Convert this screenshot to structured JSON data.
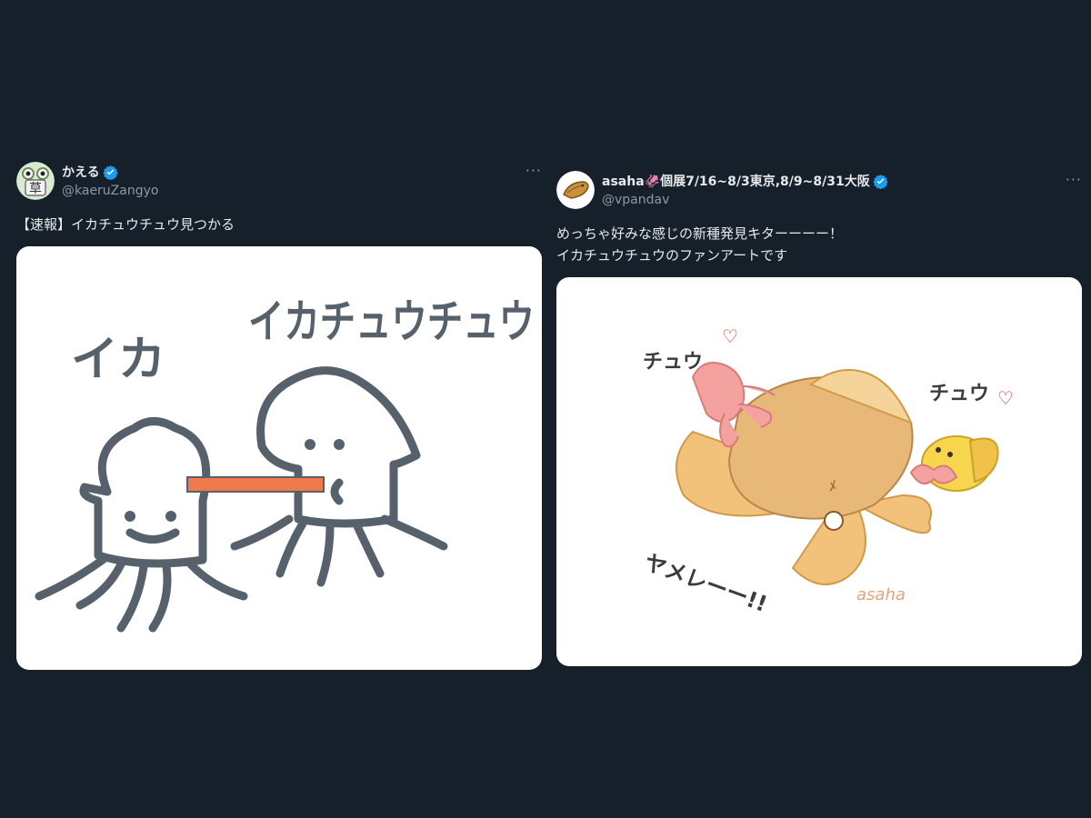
{
  "tweets": [
    {
      "display_name": "かえる",
      "handle": "@kaeruZangyo",
      "verified": true,
      "avatar_icon": "frog-avatar-icon",
      "text": "【速報】イカチュウチュウ見つかる",
      "more_label": "···",
      "media": {
        "description_icon": "squid-drawing-icon",
        "labels": [
          "イカ",
          "イカチュウチュウ"
        ]
      }
    },
    {
      "display_name": "asaha🦑個展7/16~8/3東京,8/9~8/31大阪",
      "handle": "@vpandav",
      "verified": true,
      "avatar_icon": "taiyaki-avatar-icon",
      "text": "めっちゃ好みな感じの新種発見キターーーー！\nイカチュウチュウのファンアートです",
      "more_label": "···",
      "media": {
        "description_icon": "squid-illustration-icon",
        "labels": [
          "チュウ",
          "チュウ",
          "ヤメレーー!!",
          "asaha"
        ]
      }
    }
  ],
  "colors": {
    "background": "#15202b",
    "verified_blue": "#1d9bf0",
    "secondary_text": "#8b98a5"
  }
}
